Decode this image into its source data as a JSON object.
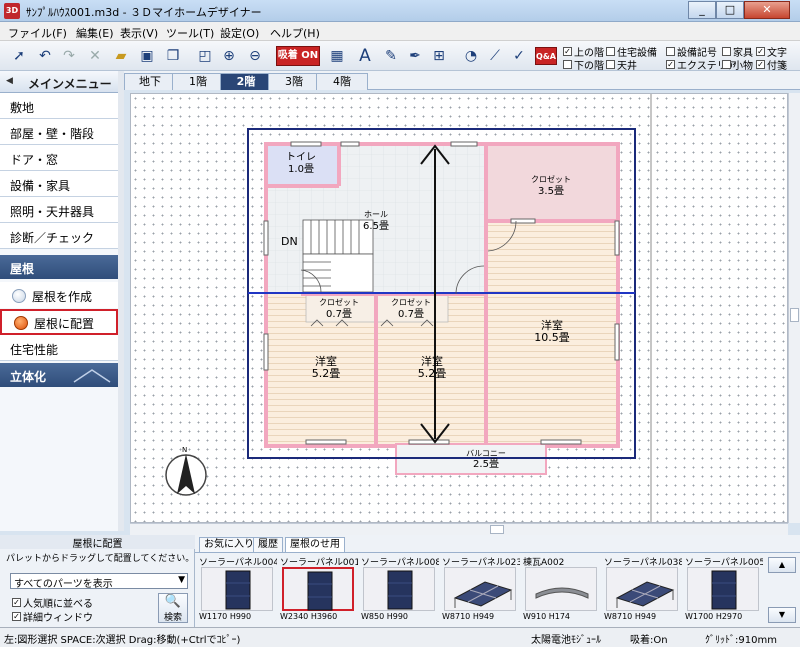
{
  "window": {
    "title": "ｻﾝﾌﾟﾙﾊｳｽ001.m3d - ３Ｄマイホームデザイナー",
    "app_icon_text": "3D"
  },
  "menu": [
    "ファイル(F)",
    "編集(E)",
    "表示(V)",
    "ツール(T)",
    "設定(O)",
    "ヘルプ(H)"
  ],
  "toolbar": {
    "snap_label": "吸着 ON",
    "qa_label": "Q&A"
  },
  "view_checks": [
    {
      "label": "上の階",
      "checked": true
    },
    {
      "label": "住宅設備",
      "checked": false
    },
    {
      "label": "設備記号",
      "checked": false
    },
    {
      "label": "家具",
      "checked": false
    },
    {
      "label": "文字",
      "checked": true
    },
    {
      "label": "下の階",
      "checked": false
    },
    {
      "label": "天井",
      "checked": false
    },
    {
      "label": "エクステリア",
      "checked": true
    },
    {
      "label": "小物",
      "checked": false
    },
    {
      "label": "付箋",
      "checked": true
    }
  ],
  "main_menu": {
    "header": "メインメニュー",
    "items": [
      "敷地",
      "部屋・壁・階段",
      "ドア・窓",
      "設備・家具",
      "照明・天井器具",
      "診断／チェック"
    ],
    "roof_section": "屋根",
    "roof_options": [
      {
        "label": "屋根を作成",
        "selected": false
      },
      {
        "label": "屋根に配置",
        "selected": true
      }
    ],
    "performance": "住宅性能",
    "solid_section": "立体化"
  },
  "floor_tabs": [
    {
      "label": "地下",
      "active": false
    },
    {
      "label": "1階",
      "active": false
    },
    {
      "label": "2階",
      "active": true
    },
    {
      "label": "3階",
      "active": false
    },
    {
      "label": "4階",
      "active": false
    }
  ],
  "plan": {
    "rooms": [
      {
        "name": "トイレ",
        "size": "1.0畳"
      },
      {
        "name": "ホール",
        "size": "6.5畳"
      },
      {
        "name": "クロゼット",
        "size": "3.5畳"
      },
      {
        "name": "クロゼット",
        "size": "0.7畳"
      },
      {
        "name": "クロゼット",
        "size": "0.7畳"
      },
      {
        "name": "洋室",
        "size": "5.2畳"
      },
      {
        "name": "洋室",
        "size": "5.2畳"
      },
      {
        "name": "洋室",
        "size": "10.5畳"
      },
      {
        "name": "バルコニー",
        "size": "2.5畳"
      }
    ],
    "stair_label": "DN",
    "north_label": "N"
  },
  "bottom_panel": {
    "title": "屋根に配置",
    "hint": "パレットからドラッグして配置してください。",
    "filter_value": "すべてのパーツを表示",
    "check_popular": "人気順に並べる",
    "check_detail": "詳細ウィンドウ",
    "search_label": "検索",
    "tabs": [
      {
        "label": "お気に入り",
        "active": false
      },
      {
        "label": "履歴",
        "active": false
      },
      {
        "label": "屋根のせ用",
        "active": true
      }
    ],
    "parts": [
      {
        "name": "ソーラーパネル004",
        "dims": "W1170 H990",
        "kind": "panel",
        "selected": false
      },
      {
        "name": "ソーラーパネル001",
        "dims": "W2340 H3960",
        "kind": "panel",
        "selected": true
      },
      {
        "name": "ソーラーパネル008",
        "dims": "W850 H990",
        "kind": "panel",
        "selected": false
      },
      {
        "name": "ソーラーパネル023",
        "dims": "W8710 H949",
        "kind": "array",
        "selected": false
      },
      {
        "name": "棟瓦A002",
        "dims": "W910 H174",
        "kind": "ridge",
        "selected": false
      },
      {
        "name": "ソーラーパネル038",
        "dims": "W8710 H949",
        "kind": "array",
        "selected": false
      },
      {
        "name": "ソーラーパネル005",
        "dims": "W1700 H2970",
        "kind": "panel",
        "selected": false
      }
    ]
  },
  "status": {
    "hint": "左:図形選択 SPACE:次選択 Drag:移動(+Ctrlでｺﾋﾟｰ)",
    "part": "太陽電池ﾓｼﾞｭｰﾙ",
    "snap": "吸着:On",
    "grid": "ｸﾞﾘｯﾄﾞ:910mm"
  }
}
